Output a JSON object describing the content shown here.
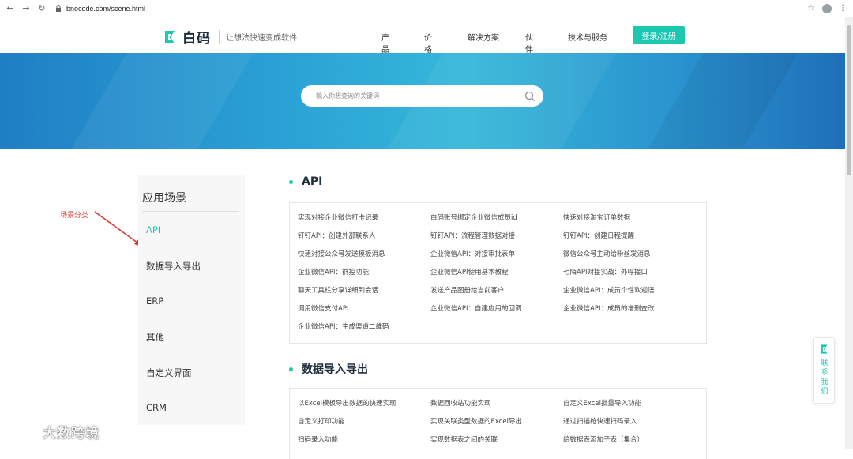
{
  "browser": {
    "url": "bnocode.com/scene.html"
  },
  "header": {
    "logo_text": "白码",
    "slogan": "让想法快速变成软件",
    "nav": [
      "产品",
      "价格",
      "解决方案",
      "伙伴",
      "技术与服务"
    ],
    "login_label": "登录/注册"
  },
  "hero": {
    "search_placeholder": "输入你想查询的关键词"
  },
  "sidebar": {
    "title": "应用场景",
    "items": [
      "API",
      "数据导入导出",
      "ERP",
      "其他",
      "自定义界面",
      "CRM"
    ],
    "active_index": 0
  },
  "annotation": {
    "label": "场景分类"
  },
  "sections": [
    {
      "title": "API",
      "links": [
        "实现对接企业微信打卡记录",
        "白码账号绑定企业微信成员id",
        "快速对接淘宝订单数据",
        "钉钉API：创建外部联系人",
        "钉钉API：流程管理数据对接",
        "钉钉API：创建日程提醒",
        "快速对接公众号发送模板消息",
        "企业微信API：对接审批表单",
        "微信公众号主动给粉丝发消息",
        "企业微信API：群控功能",
        "企业微信API使用基本教程",
        "七陌API对接实战：外呼接口",
        "聊天工具栏分享详细到会话",
        "发送产品图册给当前客户",
        "企业微信API：成员个性欢迎语",
        "调用微信支付API",
        "企业微信API：自建应用的回调",
        "企业微信API：成员的增删查改",
        "企业微信API：生成渠道二维码"
      ]
    },
    {
      "title": "数据导入导出",
      "links": [
        "以Excel模板导出数据的快速实现",
        "数据回收站功能实现",
        "自定义Excel批量导入功能",
        "自定义打印功能",
        "实现关联类型数据的Excel导出",
        "通过扫描枪快速扫码录入",
        "扫码录入功能",
        "实现数据表之间的关联",
        "给数据表添加子表（集合）"
      ]
    }
  ],
  "contact": {
    "label": "联系我们"
  },
  "watermark": {
    "text": "大数跨境"
  },
  "colors": {
    "accent": "#1cc8b0",
    "annotation": "#e03131",
    "hero_start": "#1f7fc4",
    "hero_end": "#1f6fb8"
  }
}
